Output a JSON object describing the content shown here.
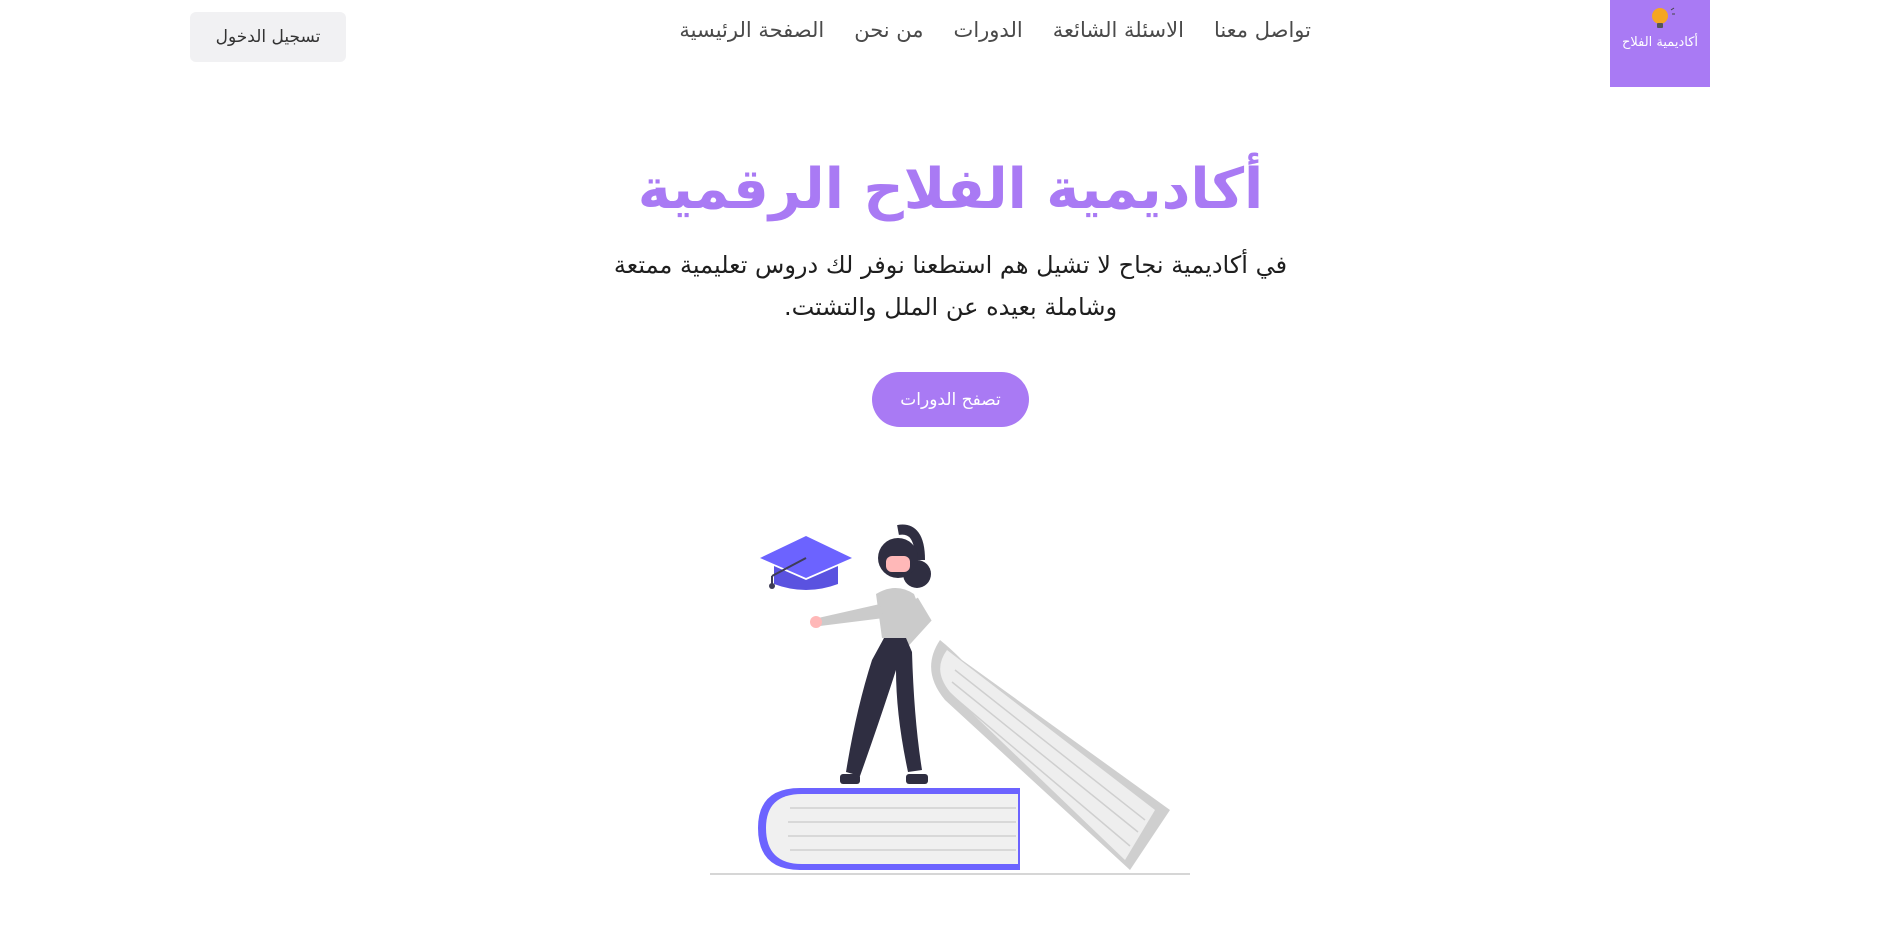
{
  "header": {
    "login_label": "تسجيل الدخول",
    "logo_text": "أكاديمية الفلاح",
    "logo_icon": "lightbulb-icon",
    "nav": [
      {
        "label": "الصفحة الرئيسية"
      },
      {
        "label": "من نحن"
      },
      {
        "label": "الدورات"
      },
      {
        "label": "الاسئلة الشائعة"
      },
      {
        "label": "تواصل معنا"
      }
    ]
  },
  "hero": {
    "title": "أكاديمية الفلاح الرقمية",
    "description": "في أكاديمية نجاح لا تشيل هم استطعنا نوفر لك دروس تعليمية ممتعة وشاملة بعيده عن الملل والتشتت.",
    "cta_label": "تصفح الدورات",
    "illustration": "student-on-books-illustration"
  },
  "colors": {
    "accent": "#a97af4",
    "illustration_primary": "#6c63ff",
    "background": "#ffffff"
  }
}
